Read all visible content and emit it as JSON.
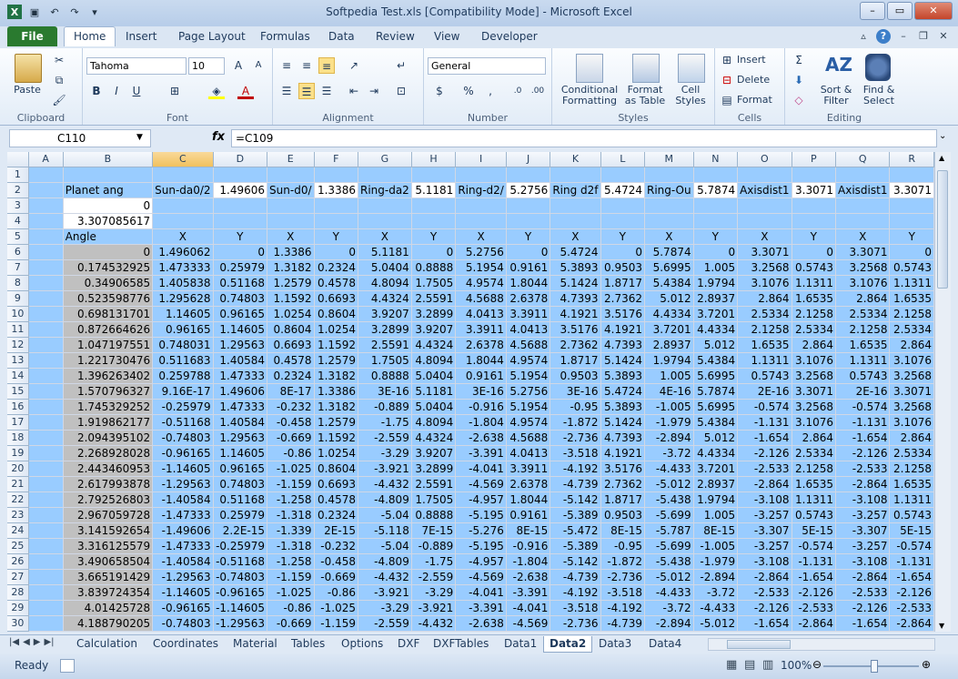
{
  "window": {
    "title": "Softpedia Test.xls  [Compatibility Mode]  -  Microsoft Excel"
  },
  "ribbon_tabs": [
    "File",
    "Home",
    "Insert",
    "Page Layout",
    "Formulas",
    "Data",
    "Review",
    "View",
    "Developer"
  ],
  "ribbon": {
    "clipboard": {
      "paste": "Paste",
      "label": "Clipboard"
    },
    "font": {
      "name": "Tahoma",
      "size": "10",
      "label": "Font"
    },
    "alignment": {
      "label": "Alignment"
    },
    "number": {
      "format": "General",
      "label": "Number"
    },
    "styles": {
      "conditional": "Conditional\nFormatting",
      "format_table": "Format\nas Table",
      "cell_styles": "Cell\nStyles",
      "label": "Styles"
    },
    "cells": {
      "insert": "Insert",
      "delete": "Delete",
      "format": "Format",
      "label": "Cells"
    },
    "editing": {
      "sort": "Sort &\nFilter",
      "find": "Find &\nSelect",
      "label": "Editing"
    }
  },
  "formula_bar": {
    "name_box": "C110",
    "fx": "fx",
    "formula": "=C109"
  },
  "columns": [
    "A",
    "B",
    "C",
    "D",
    "E",
    "F",
    "G",
    "H",
    "I",
    "J",
    "K",
    "L",
    "M",
    "N",
    "O",
    "P",
    "Q",
    "R"
  ],
  "selected_column": "C",
  "row2": {
    "B": "Planet ang",
    "C": "Sun-da0/2",
    "D": "1.49606",
    "E": "Sun-d0/",
    "F": "1.3386",
    "G": "Ring-da2",
    "H": "5.1181",
    "I": "Ring-d2/",
    "J": "5.2756",
    "K": "Ring d2f",
    "L": "5.4724",
    "M": "Ring-Ou",
    "N": "5.7874",
    "O": "Axisdist1",
    "P": "3.3071",
    "Q": "Axisdist1",
    "R": "3.3071"
  },
  "row3": {
    "B": "0"
  },
  "row4": {
    "B": "3.307085617"
  },
  "row5": {
    "B": "Angle",
    "labels": [
      "X",
      "Y",
      "X",
      "Y",
      "X",
      "Y",
      "X",
      "Y",
      "X",
      "Y",
      "X",
      "Y",
      "X",
      "Y",
      "X",
      "Y"
    ]
  },
  "data_rows": [
    {
      "row": "6",
      "cells": [
        "0",
        "1.496062",
        "0",
        "1.3386",
        "0",
        "5.1181",
        "0",
        "5.2756",
        "0",
        "5.4724",
        "0",
        "5.7874",
        "0",
        "3.3071",
        "0",
        "3.3071",
        "0"
      ]
    },
    {
      "row": "7",
      "cells": [
        "0.174532925",
        "1.473333",
        "0.25979",
        "1.3182",
        "0.2324",
        "5.0404",
        "0.8888",
        "5.1954",
        "0.9161",
        "5.3893",
        "0.9503",
        "5.6995",
        "1.005",
        "3.2568",
        "0.5743",
        "3.2568",
        "0.5743"
      ]
    },
    {
      "row": "8",
      "cells": [
        "0.34906585",
        "1.405838",
        "0.51168",
        "1.2579",
        "0.4578",
        "4.8094",
        "1.7505",
        "4.9574",
        "1.8044",
        "5.1424",
        "1.8717",
        "5.4384",
        "1.9794",
        "3.1076",
        "1.1311",
        "3.1076",
        "1.1311"
      ]
    },
    {
      "row": "9",
      "cells": [
        "0.523598776",
        "1.295628",
        "0.74803",
        "1.1592",
        "0.6693",
        "4.4324",
        "2.5591",
        "4.5688",
        "2.6378",
        "4.7393",
        "2.7362",
        "5.012",
        "2.8937",
        "2.864",
        "1.6535",
        "2.864",
        "1.6535"
      ]
    },
    {
      "row": "10",
      "cells": [
        "0.698131701",
        "1.14605",
        "0.96165",
        "1.0254",
        "0.8604",
        "3.9207",
        "3.2899",
        "4.0413",
        "3.3911",
        "4.1921",
        "3.5176",
        "4.4334",
        "3.7201",
        "2.5334",
        "2.1258",
        "2.5334",
        "2.1258"
      ]
    },
    {
      "row": "11",
      "cells": [
        "0.872664626",
        "0.96165",
        "1.14605",
        "0.8604",
        "1.0254",
        "3.2899",
        "3.9207",
        "3.3911",
        "4.0413",
        "3.5176",
        "4.1921",
        "3.7201",
        "4.4334",
        "2.1258",
        "2.5334",
        "2.1258",
        "2.5334"
      ]
    },
    {
      "row": "12",
      "cells": [
        "1.047197551",
        "0.748031",
        "1.29563",
        "0.6693",
        "1.1592",
        "2.5591",
        "4.4324",
        "2.6378",
        "4.5688",
        "2.7362",
        "4.7393",
        "2.8937",
        "5.012",
        "1.6535",
        "2.864",
        "1.6535",
        "2.864"
      ]
    },
    {
      "row": "13",
      "cells": [
        "1.221730476",
        "0.511683",
        "1.40584",
        "0.4578",
        "1.2579",
        "1.7505",
        "4.8094",
        "1.8044",
        "4.9574",
        "1.8717",
        "5.1424",
        "1.9794",
        "5.4384",
        "1.1311",
        "3.1076",
        "1.1311",
        "3.1076"
      ]
    },
    {
      "row": "14",
      "cells": [
        "1.396263402",
        "0.259788",
        "1.47333",
        "0.2324",
        "1.3182",
        "0.8888",
        "5.0404",
        "0.9161",
        "5.1954",
        "0.9503",
        "5.3893",
        "1.005",
        "5.6995",
        "0.5743",
        "3.2568",
        "0.5743",
        "3.2568"
      ]
    },
    {
      "row": "15",
      "cells": [
        "1.570796327",
        "9.16E-17",
        "1.49606",
        "8E-17",
        "1.3386",
        "3E-16",
        "5.1181",
        "3E-16",
        "5.2756",
        "3E-16",
        "5.4724",
        "4E-16",
        "5.7874",
        "2E-16",
        "3.3071",
        "2E-16",
        "3.3071"
      ]
    },
    {
      "row": "16",
      "cells": [
        "1.745329252",
        "-0.25979",
        "1.47333",
        "-0.232",
        "1.3182",
        "-0.889",
        "5.0404",
        "-0.916",
        "5.1954",
        "-0.95",
        "5.3893",
        "-1.005",
        "5.6995",
        "-0.574",
        "3.2568",
        "-0.574",
        "3.2568"
      ]
    },
    {
      "row": "17",
      "cells": [
        "1.919862177",
        "-0.51168",
        "1.40584",
        "-0.458",
        "1.2579",
        "-1.75",
        "4.8094",
        "-1.804",
        "4.9574",
        "-1.872",
        "5.1424",
        "-1.979",
        "5.4384",
        "-1.131",
        "3.1076",
        "-1.131",
        "3.1076"
      ]
    },
    {
      "row": "18",
      "cells": [
        "2.094395102",
        "-0.74803",
        "1.29563",
        "-0.669",
        "1.1592",
        "-2.559",
        "4.4324",
        "-2.638",
        "4.5688",
        "-2.736",
        "4.7393",
        "-2.894",
        "5.012",
        "-1.654",
        "2.864",
        "-1.654",
        "2.864"
      ]
    },
    {
      "row": "19",
      "cells": [
        "2.268928028",
        "-0.96165",
        "1.14605",
        "-0.86",
        "1.0254",
        "-3.29",
        "3.9207",
        "-3.391",
        "4.0413",
        "-3.518",
        "4.1921",
        "-3.72",
        "4.4334",
        "-2.126",
        "2.5334",
        "-2.126",
        "2.5334"
      ]
    },
    {
      "row": "20",
      "cells": [
        "2.443460953",
        "-1.14605",
        "0.96165",
        "-1.025",
        "0.8604",
        "-3.921",
        "3.2899",
        "-4.041",
        "3.3911",
        "-4.192",
        "3.5176",
        "-4.433",
        "3.7201",
        "-2.533",
        "2.1258",
        "-2.533",
        "2.1258"
      ]
    },
    {
      "row": "21",
      "cells": [
        "2.617993878",
        "-1.29563",
        "0.74803",
        "-1.159",
        "0.6693",
        "-4.432",
        "2.5591",
        "-4.569",
        "2.6378",
        "-4.739",
        "2.7362",
        "-5.012",
        "2.8937",
        "-2.864",
        "1.6535",
        "-2.864",
        "1.6535"
      ]
    },
    {
      "row": "22",
      "cells": [
        "2.792526803",
        "-1.40584",
        "0.51168",
        "-1.258",
        "0.4578",
        "-4.809",
        "1.7505",
        "-4.957",
        "1.8044",
        "-5.142",
        "1.8717",
        "-5.438",
        "1.9794",
        "-3.108",
        "1.1311",
        "-3.108",
        "1.1311"
      ]
    },
    {
      "row": "23",
      "cells": [
        "2.967059728",
        "-1.47333",
        "0.25979",
        "-1.318",
        "0.2324",
        "-5.04",
        "0.8888",
        "-5.195",
        "0.9161",
        "-5.389",
        "0.9503",
        "-5.699",
        "1.005",
        "-3.257",
        "0.5743",
        "-3.257",
        "0.5743"
      ]
    },
    {
      "row": "24",
      "cells": [
        "3.141592654",
        "-1.49606",
        "2.2E-15",
        "-1.339",
        "2E-15",
        "-5.118",
        "7E-15",
        "-5.276",
        "8E-15",
        "-5.472",
        "8E-15",
        "-5.787",
        "8E-15",
        "-3.307",
        "5E-15",
        "-3.307",
        "5E-15"
      ]
    },
    {
      "row": "25",
      "cells": [
        "3.316125579",
        "-1.47333",
        "-0.25979",
        "-1.318",
        "-0.232",
        "-5.04",
        "-0.889",
        "-5.195",
        "-0.916",
        "-5.389",
        "-0.95",
        "-5.699",
        "-1.005",
        "-3.257",
        "-0.574",
        "-3.257",
        "-0.574"
      ]
    },
    {
      "row": "26",
      "cells": [
        "3.490658504",
        "-1.40584",
        "-0.51168",
        "-1.258",
        "-0.458",
        "-4.809",
        "-1.75",
        "-4.957",
        "-1.804",
        "-5.142",
        "-1.872",
        "-5.438",
        "-1.979",
        "-3.108",
        "-1.131",
        "-3.108",
        "-1.131"
      ]
    },
    {
      "row": "27",
      "cells": [
        "3.665191429",
        "-1.29563",
        "-0.74803",
        "-1.159",
        "-0.669",
        "-4.432",
        "-2.559",
        "-4.569",
        "-2.638",
        "-4.739",
        "-2.736",
        "-5.012",
        "-2.894",
        "-2.864",
        "-1.654",
        "-2.864",
        "-1.654"
      ]
    },
    {
      "row": "28",
      "cells": [
        "3.839724354",
        "-1.14605",
        "-0.96165",
        "-1.025",
        "-0.86",
        "-3.921",
        "-3.29",
        "-4.041",
        "-3.391",
        "-4.192",
        "-3.518",
        "-4.433",
        "-3.72",
        "-2.533",
        "-2.126",
        "-2.533",
        "-2.126"
      ]
    },
    {
      "row": "29",
      "cells": [
        "4.01425728",
        "-0.96165",
        "-1.14605",
        "-0.86",
        "-1.025",
        "-3.29",
        "-3.921",
        "-3.391",
        "-4.041",
        "-3.518",
        "-4.192",
        "-3.72",
        "-4.433",
        "-2.126",
        "-2.533",
        "-2.126",
        "-2.533"
      ]
    },
    {
      "row": "30",
      "cells": [
        "4.188790205",
        "-0.74803",
        "-1.29563",
        "-0.669",
        "-1.159",
        "-2.559",
        "-4.432",
        "-2.638",
        "-4.569",
        "-2.736",
        "-4.739",
        "-2.894",
        "-5.012",
        "-1.654",
        "-2.864",
        "-1.654",
        "-2.864"
      ]
    }
  ],
  "sheet_tabs": [
    "Calculation",
    "Coordinates",
    "Material",
    "Tables",
    "Options",
    "DXF",
    "DXFTables",
    "Data1",
    "Data2",
    "Data3",
    "Data4"
  ],
  "active_sheet": "Data2",
  "status": {
    "ready": "Ready",
    "zoom": "100%"
  },
  "colors": {
    "data_fill": "#99ccff",
    "angle_fill": "#c0c0c0",
    "file_tab": "#2a7a2f"
  }
}
